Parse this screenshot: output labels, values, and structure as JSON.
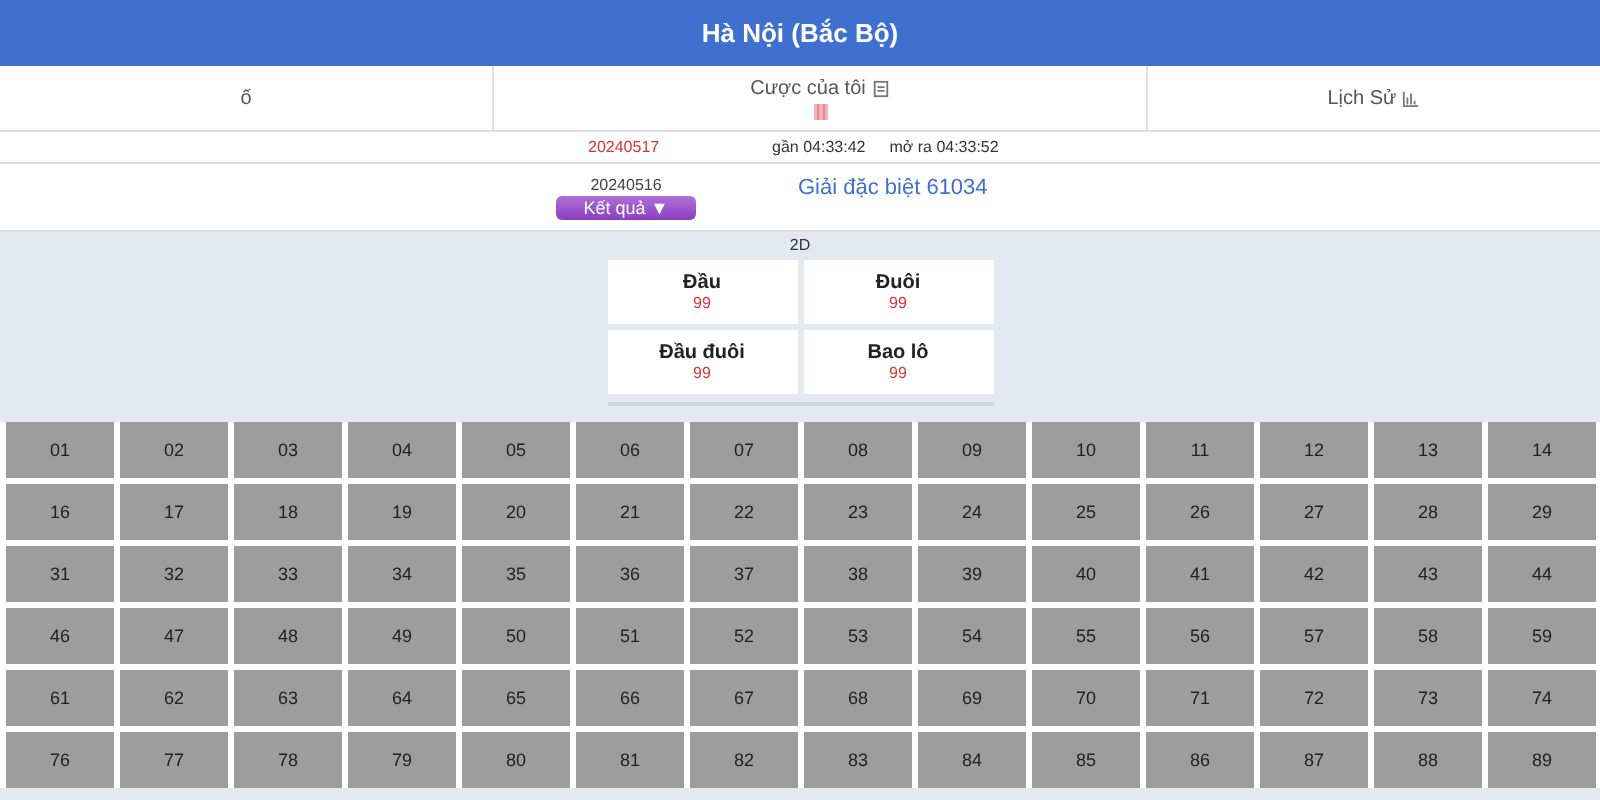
{
  "header": {
    "title": "Hà Nội (Bắc Bộ)"
  },
  "tabs": [
    {
      "label": "ố",
      "selected": false
    },
    {
      "label": "Cược của tôi",
      "selected": false
    },
    {
      "label": "Lịch Sử",
      "selected": false
    }
  ],
  "draw": {
    "current_date": "20240517",
    "close_time": "gần 04:33:42",
    "open_time": "mở ra 04:33:52"
  },
  "result": {
    "previous_date": "20240516",
    "button": "Kết quả ▼",
    "special_prize": "Giải đặc biệt 61034"
  },
  "game": {
    "title": "2D",
    "options": [
      {
        "name": "Đầu",
        "odds": "99"
      },
      {
        "name": "Đuôi",
        "odds": "99"
      },
      {
        "name": "Đầu đuôi",
        "odds": "99"
      },
      {
        "name": "Bao lô",
        "odds": "99"
      }
    ]
  },
  "numbers": [
    [
      "01",
      "02",
      "03",
      "04",
      "05",
      "06",
      "07",
      "08",
      "09",
      "10",
      "11",
      "12",
      "13",
      "14"
    ],
    [
      "16",
      "17",
      "18",
      "19",
      "20",
      "21",
      "22",
      "23",
      "24",
      "25",
      "26",
      "27",
      "28",
      "29"
    ],
    [
      "31",
      "32",
      "33",
      "34",
      "35",
      "36",
      "37",
      "38",
      "39",
      "40",
      "41",
      "42",
      "43",
      "44"
    ],
    [
      "46",
      "47",
      "48",
      "49",
      "50",
      "51",
      "52",
      "53",
      "54",
      "55",
      "56",
      "57",
      "58",
      "59"
    ],
    [
      "61",
      "62",
      "63",
      "64",
      "65",
      "66",
      "67",
      "68",
      "69",
      "70",
      "71",
      "72",
      "73",
      "74"
    ],
    [
      "76",
      "77",
      "78",
      "79",
      "80",
      "81",
      "82",
      "83",
      "84",
      "85",
      "86",
      "87",
      "88",
      "89"
    ]
  ]
}
